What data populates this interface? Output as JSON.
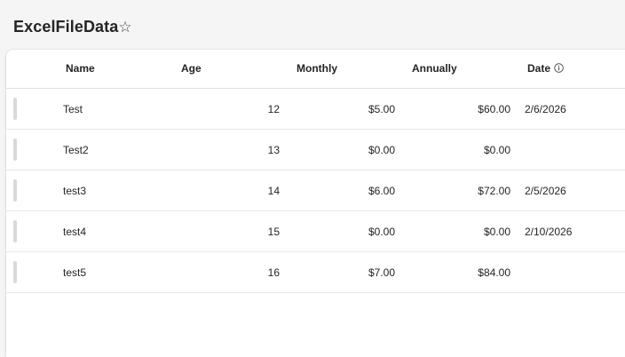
{
  "header": {
    "title": "ExcelFileData",
    "star_glyph": "☆"
  },
  "table": {
    "columns": {
      "name": "Name",
      "age": "Age",
      "monthly": "Monthly",
      "annually": "Annually",
      "date": "Date"
    },
    "rows": [
      {
        "name": "Test",
        "age": "12",
        "monthly": "$5.00",
        "annually": "$60.00",
        "date": "2/6/2026"
      },
      {
        "name": "Test2",
        "age": "13",
        "monthly": "$0.00",
        "annually": "$0.00",
        "date": ""
      },
      {
        "name": "test3",
        "age": "14",
        "monthly": "$6.00",
        "annually": "$72.00",
        "date": "2/5/2026"
      },
      {
        "name": "test4",
        "age": "15",
        "monthly": "$0.00",
        "annually": "$0.00",
        "date": "2/10/2026"
      },
      {
        "name": "test5",
        "age": "16",
        "monthly": "$7.00",
        "annually": "$84.00",
        "date": ""
      }
    ]
  },
  "icons": {
    "favorite": "star-outline-icon",
    "column_info": "info-circle-icon"
  },
  "colors": {
    "background": "#f5f5f5",
    "card": "#ffffff",
    "text": "#242424",
    "row_handle": "#d9d9d9"
  }
}
